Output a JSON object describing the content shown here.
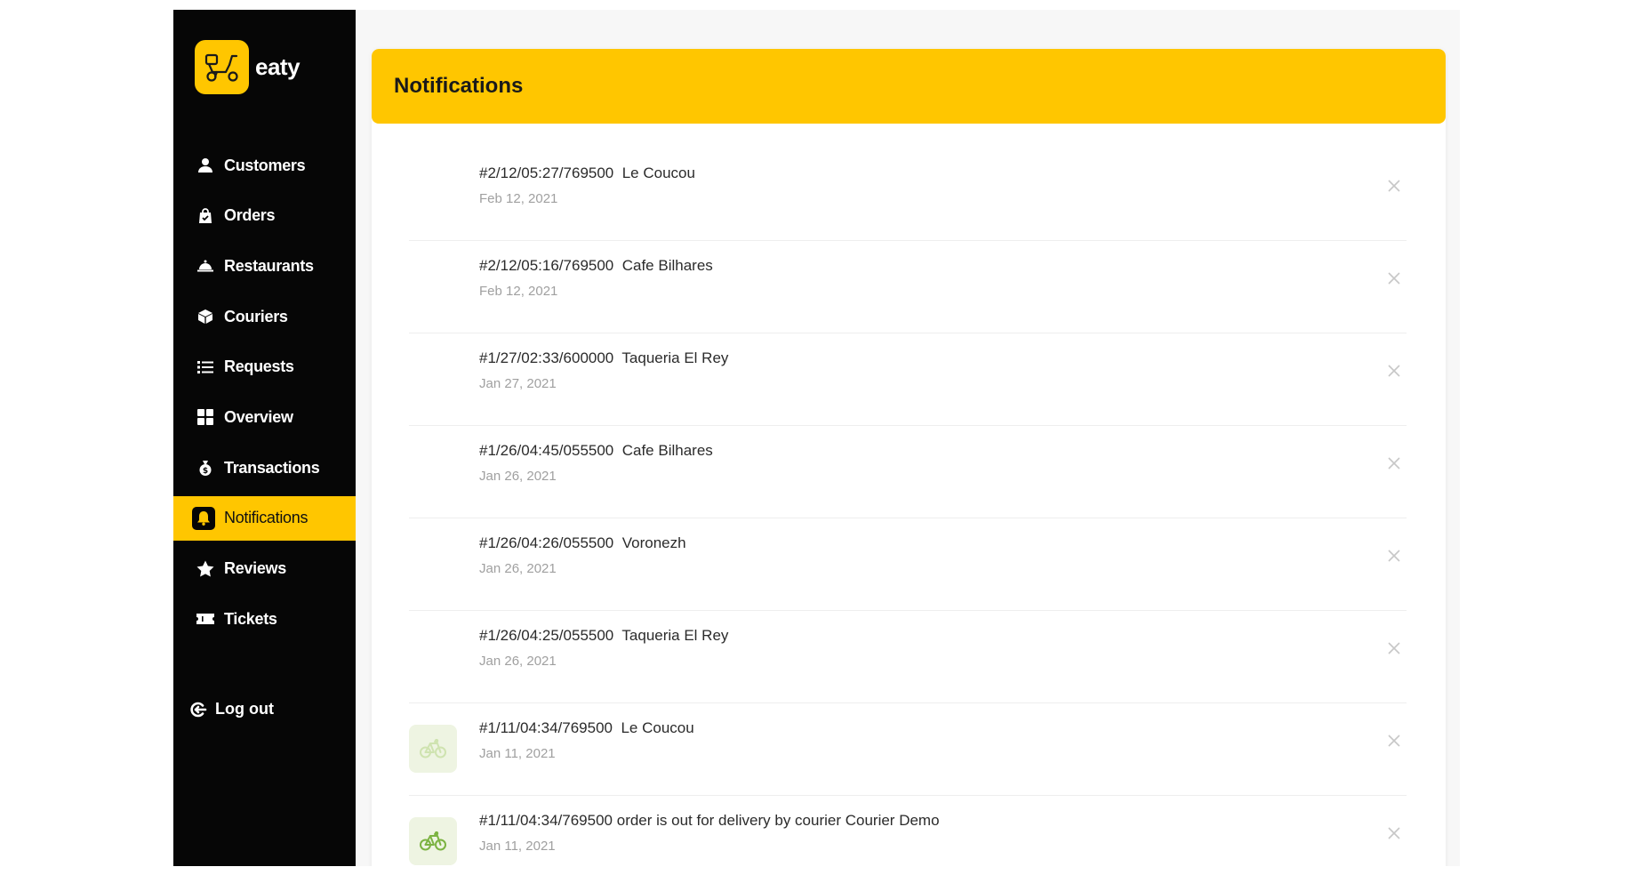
{
  "brand": {
    "name": "eaty"
  },
  "sidebar": {
    "items": [
      {
        "label": "Customers",
        "icon": "user-icon",
        "active": false
      },
      {
        "label": "Orders",
        "icon": "shopping-bag-icon",
        "active": false
      },
      {
        "label": "Restaurants",
        "icon": "cloche-icon",
        "active": false
      },
      {
        "label": "Couriers",
        "icon": "box-icon",
        "active": false
      },
      {
        "label": "Requests",
        "icon": "list-icon",
        "active": false
      },
      {
        "label": "Overview",
        "icon": "grid-icon",
        "active": false
      },
      {
        "label": "Transactions",
        "icon": "money-bag-icon",
        "active": false
      },
      {
        "label": "Notifications",
        "icon": "bell-icon",
        "active": true
      },
      {
        "label": "Reviews",
        "icon": "star-icon",
        "active": false
      },
      {
        "label": "Tickets",
        "icon": "ticket-icon",
        "active": false
      }
    ],
    "logout_label": "Log out"
  },
  "page": {
    "title": "Notifications"
  },
  "notifications": [
    {
      "code": "#2/12/05:27/769500",
      "text": "Le Coucou",
      "date": "Feb 12, 2021",
      "icon": ""
    },
    {
      "code": "#2/12/05:16/769500",
      "text": "Cafe Bilhares",
      "date": "Feb 12, 2021",
      "icon": ""
    },
    {
      "code": "#1/27/02:33/600000",
      "text": "Taqueria El Rey",
      "date": "Jan 27, 2021",
      "icon": ""
    },
    {
      "code": "#1/26/04:45/055500",
      "text": "Cafe Bilhares",
      "date": "Jan 26, 2021",
      "icon": ""
    },
    {
      "code": "#1/26/04:26/055500",
      "text": "Voronezh",
      "date": "Jan 26, 2021",
      "icon": ""
    },
    {
      "code": "#1/26/04:25/055500",
      "text": "Taqueria El Rey",
      "date": "Jan 26, 2021",
      "icon": ""
    },
    {
      "code": "#1/11/04:34/769500",
      "text": "Le Coucou",
      "date": "Jan 11, 2021",
      "icon": "bicycle-icon-faded"
    },
    {
      "code": "#1/11/04:34/769500",
      "text": "order is out for delivery by courier Courier Demo",
      "date": "Jan 11, 2021",
      "icon": "bicycle-icon"
    }
  ],
  "colors": {
    "accent": "#ffc600",
    "sidebar_bg": "#060606",
    "bike_green": "#7cb342",
    "bike_green_faded": "#cfe3b0"
  }
}
